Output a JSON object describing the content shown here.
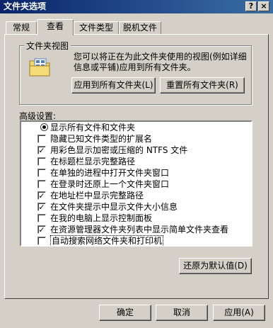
{
  "window": {
    "title": "文件夹选项",
    "help_button": "?",
    "close_button": "×"
  },
  "tabs": [
    {
      "label": "常规",
      "active": false
    },
    {
      "label": "查看",
      "active": true
    },
    {
      "label": "文件类型",
      "active": false
    },
    {
      "label": "脱机文件",
      "active": false
    }
  ],
  "folder_views": {
    "legend": "文件夹视图",
    "description": "您可以将正在为此文件夹使用的视图(例如详细信息或平铺)应用到所有文件夹。",
    "apply_all_label": "应用到所有文件夹(L)",
    "reset_all_label": "重置所有文件夹(R)"
  },
  "advanced": {
    "label": "高级设置:",
    "items": [
      {
        "type": "radio",
        "checked": true,
        "label": "显示所有文件和文件夹"
      },
      {
        "type": "check",
        "checked": false,
        "label": "隐藏已知文件类型的扩展名"
      },
      {
        "type": "check",
        "checked": true,
        "label": "用彩色显示加密或压缩的 NTFS 文件"
      },
      {
        "type": "check",
        "checked": false,
        "label": "在标题栏显示完整路径"
      },
      {
        "type": "check",
        "checked": false,
        "label": "在单独的进程中打开文件夹窗口"
      },
      {
        "type": "check",
        "checked": false,
        "label": "在登录时还原上一个文件夹窗口"
      },
      {
        "type": "check",
        "checked": true,
        "label": "在地址栏中显示完整路径"
      },
      {
        "type": "check",
        "checked": true,
        "label": "在文件夹提示中显示文件大小信息"
      },
      {
        "type": "check",
        "checked": false,
        "label": "在我的电脑上显示控制面板"
      },
      {
        "type": "check",
        "checked": true,
        "label": "在资源管理器文件夹列表中显示简单文件夹查看"
      },
      {
        "type": "check",
        "checked": false,
        "label": "自动搜索网络文件夹和打印机",
        "selected": true
      }
    ],
    "restore_defaults_label": "还原为默认值(D)"
  },
  "footer": {
    "ok_label": "确定",
    "cancel_label": "取消",
    "apply_label": "应用(A)"
  },
  "icons": {
    "folder": "folder-options-icon",
    "scroll_up": "scroll-up-arrow-icon",
    "scroll_down": "scroll-down-arrow-icon"
  }
}
